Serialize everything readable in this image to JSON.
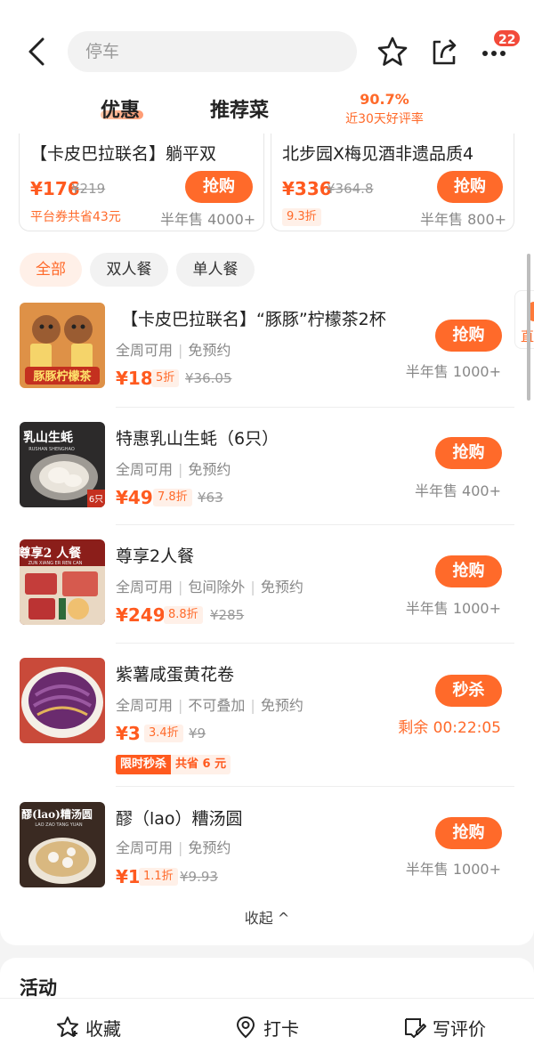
{
  "search": {
    "placeholder": "停车"
  },
  "header": {
    "notification_count": "22"
  },
  "tabs": {
    "discounts": "优惠",
    "recommended": "推荐菜"
  },
  "rating": {
    "value": "90.7%",
    "label": "近30天好评率"
  },
  "top_cards": [
    {
      "title": "【卡皮巴拉联名】躺平双",
      "price": "¥176",
      "original": "¥219",
      "note": "平台券共省43元",
      "sold": "半年售 4000+",
      "button": "抢购"
    },
    {
      "title": "北步园X梅见酒非遗品质4",
      "price": "¥336",
      "original": "¥364.8",
      "discount": "9.3折",
      "sold": "半年售 800+",
      "button": "抢购"
    }
  ],
  "filters": [
    "全部",
    "双人餐",
    "单人餐"
  ],
  "deals": [
    {
      "title": "【卡皮巴拉联名】“豚豚”柠檬茶2杯",
      "tags": [
        "全周可用",
        "免预约"
      ],
      "price": "¥18",
      "discount": "5折",
      "original": "¥36.05",
      "button": "抢购",
      "sold": "半年售 1000+",
      "thumb_text": "豚豚柠檬茶"
    },
    {
      "title": "特惠乳山生蚝（6只）",
      "tags": [
        "全周可用",
        "免预约"
      ],
      "price": "¥49",
      "discount": "7.8折",
      "original": "¥63",
      "button": "抢购",
      "sold": "半年售 400+",
      "thumb_text": "乳山生蚝",
      "thumb_sub": "RUSHAN SHENGHAO",
      "thumb_badge": "6只"
    },
    {
      "title": "尊享2人餐",
      "tags": [
        "全周可用",
        "包间除外",
        "免预约"
      ],
      "price": "¥249",
      "discount": "8.8折",
      "original": "¥285",
      "button": "抢购",
      "sold": "半年售 1000+",
      "thumb_text": "尊享2 人餐",
      "thumb_sub": "ZUN XIANG ER REN CAN"
    },
    {
      "title": "紫薯咸蛋黄花卷",
      "tags": [
        "全周可用",
        "不可叠加",
        "免预约"
      ],
      "price": "¥3",
      "discount": "3.4折",
      "original": "¥9",
      "button": "秒杀",
      "countdown": "剩余 00:22:05",
      "flash_label": "限时秒杀",
      "flash_saving": "共省 6 元"
    },
    {
      "title": "醪（lao）糟汤圆",
      "tags": [
        "全周可用",
        "免预约"
      ],
      "price": "¥1",
      "discount": "1.1折",
      "original": "¥9.93",
      "button": "抢购",
      "sold": "半年售 1000+",
      "thumb_text": "醪(lao)糟汤圆",
      "thumb_sub": "LAO ZAO TANG YUAN"
    }
  ],
  "collapse_label": "收起 ^",
  "side_tab_label": "直",
  "activity": {
    "title": "活动"
  },
  "bottom_bar": {
    "favorite": "收藏",
    "checkin": "打卡",
    "review": "写评价"
  },
  "colors": {
    "accent": "#ff6a2a",
    "badge": "#f24a3a"
  }
}
